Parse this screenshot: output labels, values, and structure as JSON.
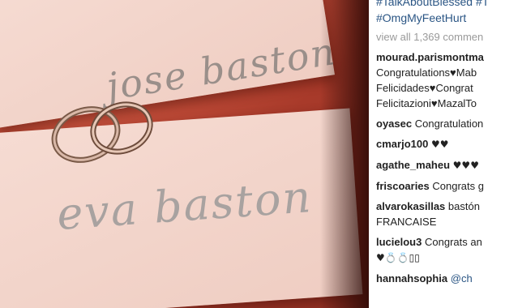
{
  "caption": {
    "hashtags_line1": "#TalkAboutBlessed #T",
    "hashtags_line2": "#OmgMyFeetHurt"
  },
  "photo": {
    "card_top_name": "jose baston",
    "card_bottom_name": "eva baston"
  },
  "view_all_label": "view all 1,369 commen",
  "comments": [
    {
      "user": "mourad.parismontma",
      "lines": [
        "Congratulations♥Mab",
        "Felicidades♥Congrat",
        "Felicitazioni♥MazalTo"
      ]
    },
    {
      "user": "oyasec",
      "text": "Congratulation"
    },
    {
      "user": "cmarjo100",
      "text": "♥♥"
    },
    {
      "user": "agathe_maheu",
      "text": "♥♥♥"
    },
    {
      "user": "friscoaries",
      "text": "Congrats g"
    },
    {
      "user": "alvarokasillas",
      "text": "bastón",
      "line2": "FRANCAISE"
    },
    {
      "user": "lucielou3",
      "text": "Congrats an",
      "line2": "♥💍💍▯▯"
    },
    {
      "user": "hannahsophia",
      "mention": "@ch"
    }
  ]
}
